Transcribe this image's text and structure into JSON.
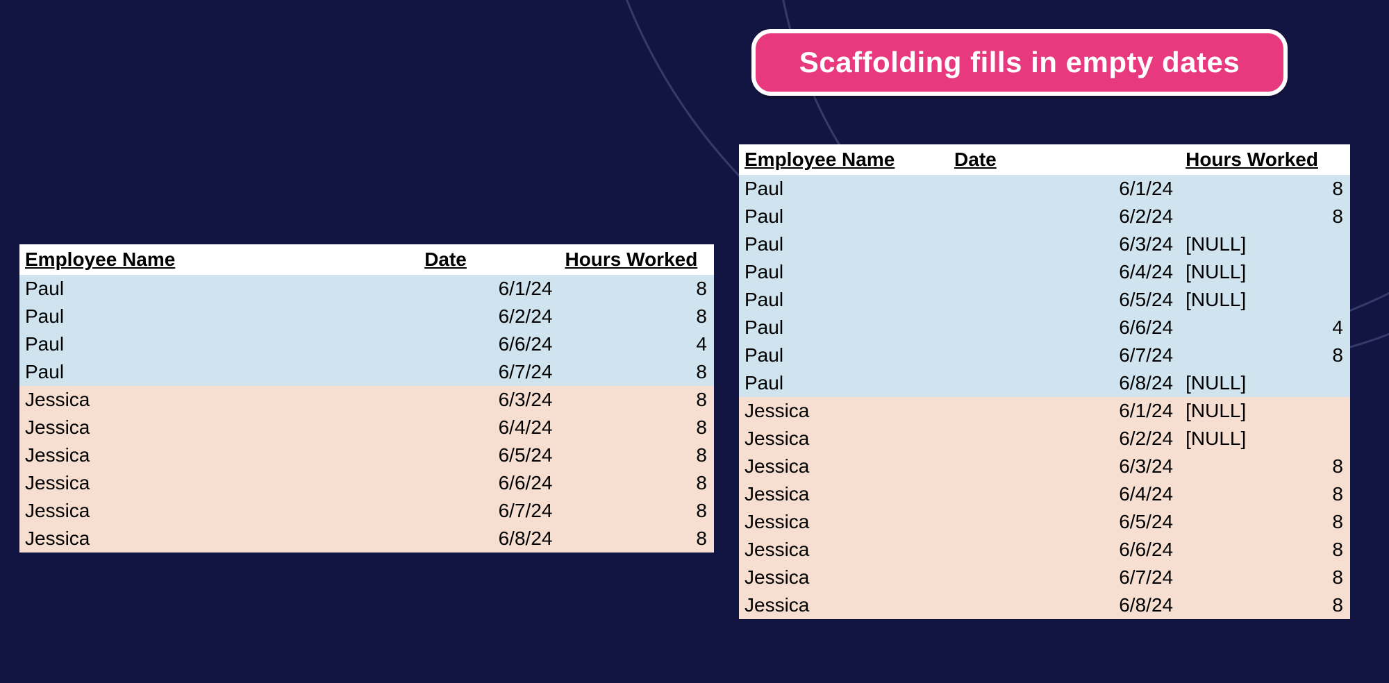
{
  "callout": "Scaffolding fills in empty dates",
  "columns": {
    "name": "Employee Name",
    "date": "Date",
    "hours": "Hours Worked"
  },
  "left_table": {
    "rows": [
      {
        "group": "paul",
        "name": "Paul",
        "date": "6/1/24",
        "hours": "8"
      },
      {
        "group": "paul",
        "name": "Paul",
        "date": "6/2/24",
        "hours": "8"
      },
      {
        "group": "paul",
        "name": "Paul",
        "date": "6/6/24",
        "hours": "4"
      },
      {
        "group": "paul",
        "name": "Paul",
        "date": "6/7/24",
        "hours": "8"
      },
      {
        "group": "jessica",
        "name": "Jessica",
        "date": "6/3/24",
        "hours": "8"
      },
      {
        "group": "jessica",
        "name": "Jessica",
        "date": "6/4/24",
        "hours": "8"
      },
      {
        "group": "jessica",
        "name": "Jessica",
        "date": "6/5/24",
        "hours": "8"
      },
      {
        "group": "jessica",
        "name": "Jessica",
        "date": "6/6/24",
        "hours": "8"
      },
      {
        "group": "jessica",
        "name": "Jessica",
        "date": "6/7/24",
        "hours": "8"
      },
      {
        "group": "jessica",
        "name": "Jessica",
        "date": "6/8/24",
        "hours": "8"
      }
    ]
  },
  "right_table": {
    "rows": [
      {
        "group": "paul",
        "name": "Paul",
        "date": "6/1/24",
        "hours": "8"
      },
      {
        "group": "paul",
        "name": "Paul",
        "date": "6/2/24",
        "hours": "8"
      },
      {
        "group": "paul",
        "name": "Paul",
        "date": "6/3/24",
        "hours": "[NULL]"
      },
      {
        "group": "paul",
        "name": "Paul",
        "date": "6/4/24",
        "hours": "[NULL]"
      },
      {
        "group": "paul",
        "name": "Paul",
        "date": "6/5/24",
        "hours": "[NULL]"
      },
      {
        "group": "paul",
        "name": "Paul",
        "date": "6/6/24",
        "hours": "4"
      },
      {
        "group": "paul",
        "name": "Paul",
        "date": "6/7/24",
        "hours": "8"
      },
      {
        "group": "paul",
        "name": "Paul",
        "date": "6/8/24",
        "hours": "[NULL]"
      },
      {
        "group": "jessica",
        "name": "Jessica",
        "date": "6/1/24",
        "hours": "[NULL]"
      },
      {
        "group": "jessica",
        "name": "Jessica",
        "date": "6/2/24",
        "hours": "[NULL]"
      },
      {
        "group": "jessica",
        "name": "Jessica",
        "date": "6/3/24",
        "hours": "8"
      },
      {
        "group": "jessica",
        "name": "Jessica",
        "date": "6/4/24",
        "hours": "8"
      },
      {
        "group": "jessica",
        "name": "Jessica",
        "date": "6/5/24",
        "hours": "8"
      },
      {
        "group": "jessica",
        "name": "Jessica",
        "date": "6/6/24",
        "hours": "8"
      },
      {
        "group": "jessica",
        "name": "Jessica",
        "date": "6/7/24",
        "hours": "8"
      },
      {
        "group": "jessica",
        "name": "Jessica",
        "date": "6/8/24",
        "hours": "8"
      }
    ]
  }
}
